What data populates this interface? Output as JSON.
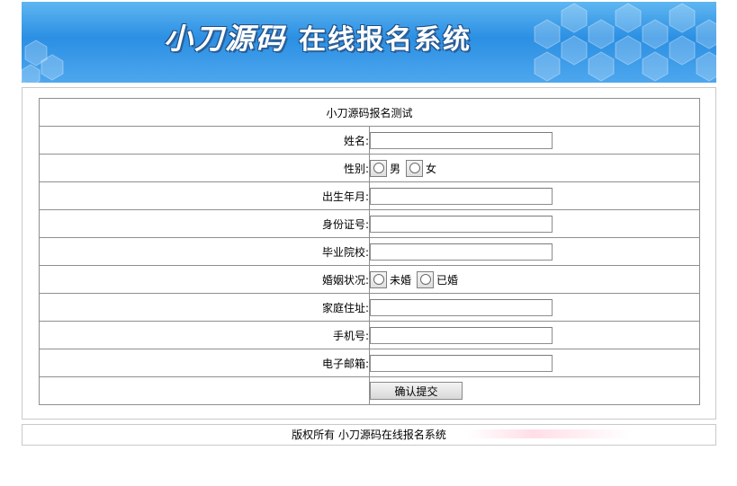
{
  "banner": {
    "brand": "小刀源码",
    "subtitle": "在线报名系统"
  },
  "form": {
    "caption": "小刀源码报名测试",
    "fields": [
      {
        "label": "姓名:",
        "type": "text",
        "value": ""
      },
      {
        "label": "性别:",
        "type": "radio",
        "options": [
          "男",
          "女"
        ]
      },
      {
        "label": "出生年月:",
        "type": "text",
        "value": ""
      },
      {
        "label": "身份证号:",
        "type": "text",
        "value": ""
      },
      {
        "label": "毕业院校:",
        "type": "text",
        "value": ""
      },
      {
        "label": "婚姻状况:",
        "type": "radio",
        "options": [
          "未婚",
          "已婚"
        ]
      },
      {
        "label": "家庭住址:",
        "type": "text",
        "value": ""
      },
      {
        "label": "手机号:",
        "type": "text",
        "value": ""
      },
      {
        "label": "电子邮箱:",
        "type": "text",
        "value": ""
      }
    ],
    "submit_label": "确认提交"
  },
  "footer": {
    "text": "版权所有 小刀源码在线报名系统"
  },
  "colors": {
    "banner": "#2b8fe3",
    "border": "#8f8f8f"
  }
}
